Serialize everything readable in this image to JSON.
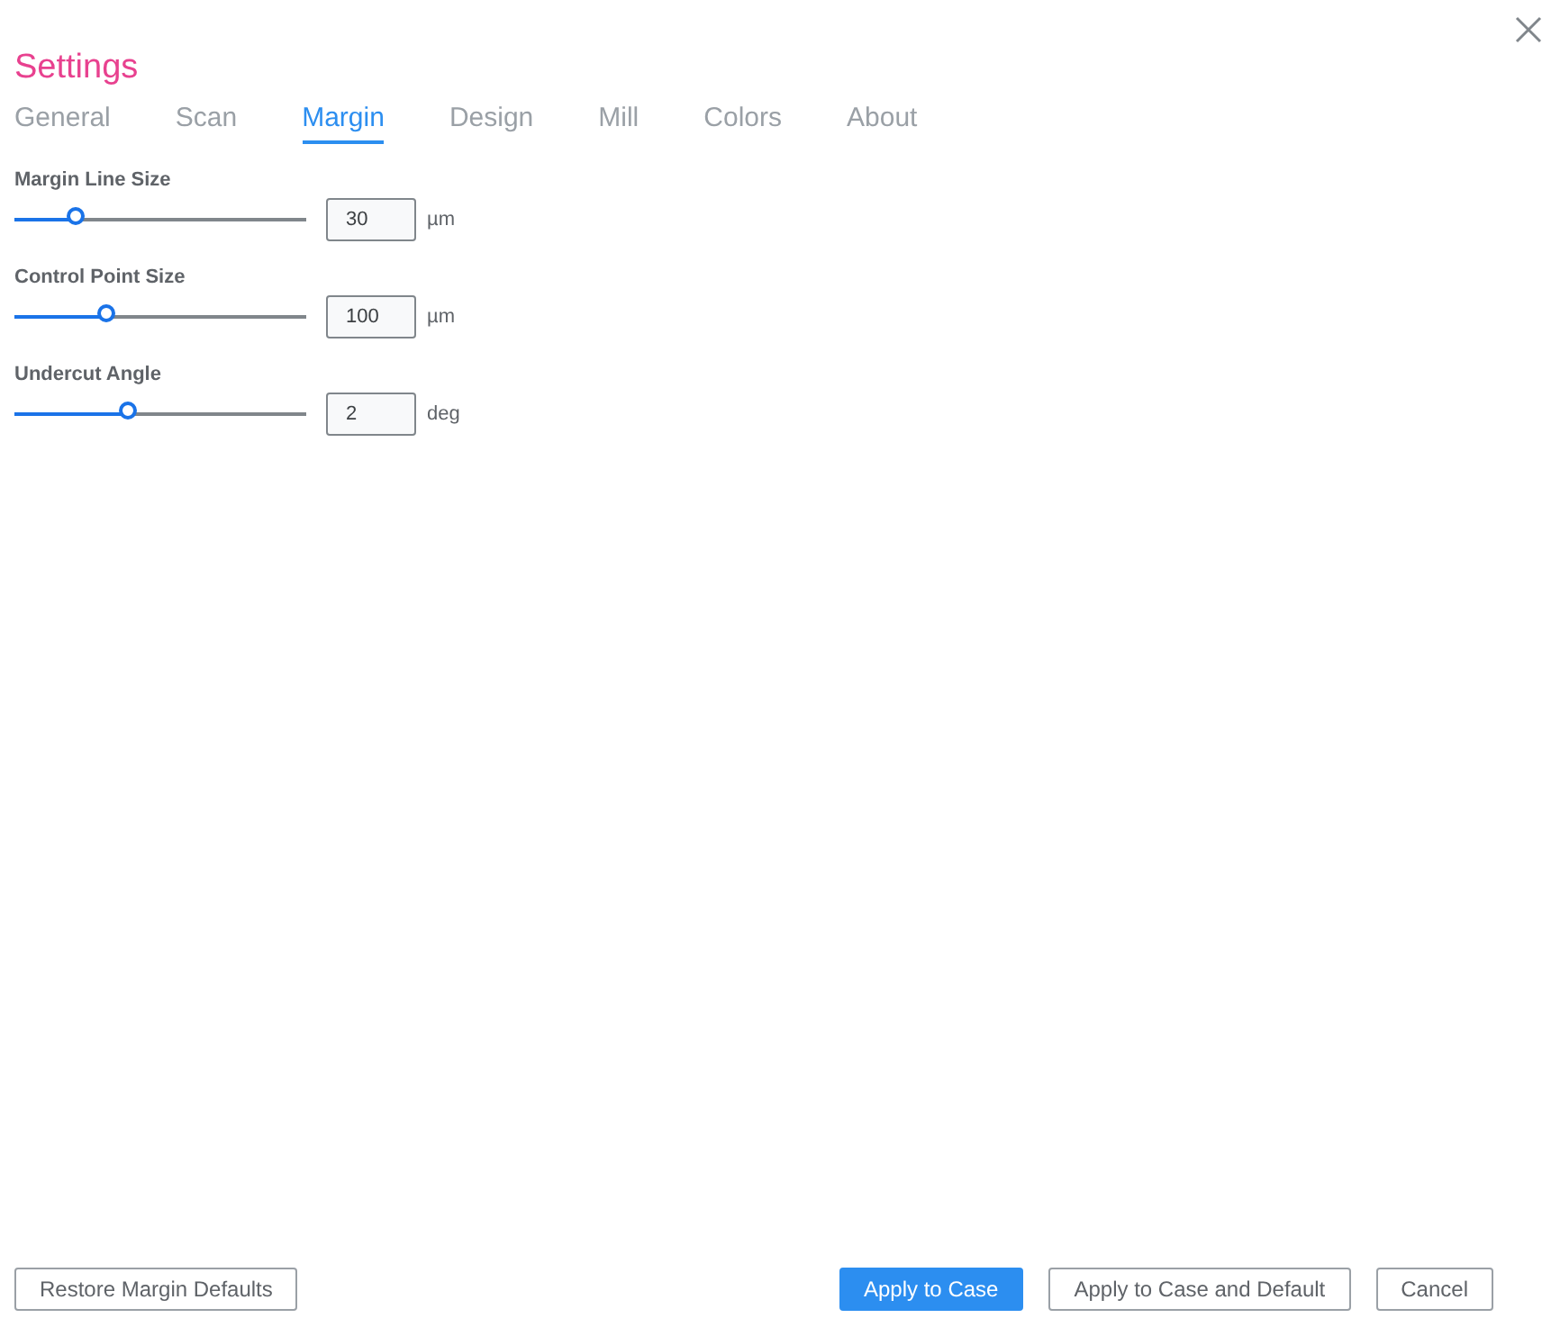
{
  "window": {
    "title": "Settings"
  },
  "tabs": [
    {
      "label": "General",
      "selected": false
    },
    {
      "label": "Scan",
      "selected": false
    },
    {
      "label": "Margin",
      "selected": true
    },
    {
      "label": "Design",
      "selected": false
    },
    {
      "label": "Mill",
      "selected": false
    },
    {
      "label": "Colors",
      "selected": false
    },
    {
      "label": "About",
      "selected": false
    }
  ],
  "settings": [
    {
      "label": "Margin Line Size",
      "level": 0.22,
      "value": "30",
      "unit": "µm"
    },
    {
      "label": "Control Point Size",
      "level": 0.33,
      "value": "100",
      "unit": "µm"
    },
    {
      "label": "Undercut Angle",
      "level": 0.4,
      "value": "2",
      "unit": "deg"
    }
  ],
  "footer": {
    "left_buttons": [
      {
        "label": "Restore Margin Defaults",
        "primary": false
      }
    ],
    "right_buttons": [
      {
        "label": "Apply to Case",
        "primary": true
      },
      {
        "label": "Apply to Case and Default",
        "primary": false
      },
      {
        "label": "Cancel",
        "primary": false
      }
    ]
  }
}
